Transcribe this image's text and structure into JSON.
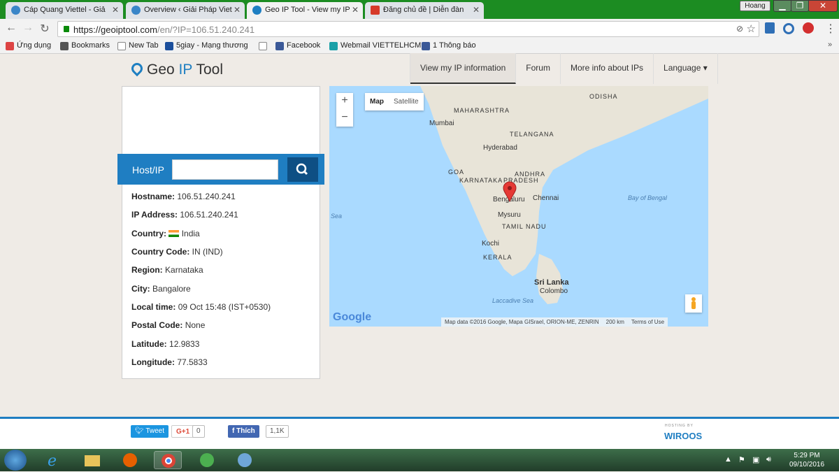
{
  "browser": {
    "tabs": [
      {
        "title": "Cáp Quang Viettel - Giả",
        "favicon_color": "#3a86c8"
      },
      {
        "title": "Overview ‹ Giải Pháp Viet",
        "favicon_color": "#3a86c8"
      },
      {
        "title": "Geo IP Tool - View my IP",
        "favicon_color": "#1e7fc2",
        "active": true
      },
      {
        "title": "Đăng chủ đề | Diễn đàn",
        "favicon_color": "#d63a2a"
      }
    ],
    "user": "Hoang",
    "url_main": "https://geoiptool.com",
    "url_rest": "/en/?IP=106.51.240.241",
    "bookmarks": [
      {
        "label": "Ứng dụng",
        "icon_color": "#d44"
      },
      {
        "label": "Bookmarks",
        "icon_color": "#555"
      },
      {
        "label": "New Tab",
        "icon_color": "#888"
      },
      {
        "label": "5giay - Mạng thương",
        "icon_color": "#1b4f9c"
      },
      {
        "label": "",
        "icon_color": "#888"
      },
      {
        "label": "Facebook",
        "icon_color": "#3b5998"
      },
      {
        "label": "Webmail VIETTELHCM",
        "icon_color": "#1aa0a8"
      },
      {
        "label": "1 Thông báo",
        "icon_color": "#3b5998"
      }
    ]
  },
  "site": {
    "logo_geo": "Geo ",
    "logo_ip": "IP",
    "logo_tool": " Tool",
    "nav": [
      "View my IP information",
      "Forum",
      "More info about IPs",
      "Language ▾"
    ]
  },
  "lookup": {
    "label": "Host/IP",
    "input_value": "",
    "search_icon": "search-icon"
  },
  "info": [
    {
      "label": "Hostname:",
      "value": "106.51.240.241"
    },
    {
      "label": "IP Address:",
      "value": "106.51.240.241"
    },
    {
      "label": "Country:",
      "value": "India"
    },
    {
      "label": "Country Code:",
      "value": "IN (IND)"
    },
    {
      "label": "Region:",
      "value": "Karnataka"
    },
    {
      "label": "City:",
      "value": "Bangalore"
    },
    {
      "label": "Local time:",
      "value": "09 Oct 15:48 (IST+0530)"
    },
    {
      "label": "Postal Code:",
      "value": "None"
    },
    {
      "label": "Latitude:",
      "value": "12.9833"
    },
    {
      "label": "Longitude:",
      "value": "77.5833"
    }
  ],
  "map": {
    "zoom_in": "+",
    "zoom_out": "−",
    "type_map": "Map",
    "type_satellite": "Satellite",
    "labels": [
      "ODISHA",
      "MAHARASHTRA",
      "Mumbai",
      "TELANGANA",
      "Hyderabad",
      "GOA",
      "ANDHRA",
      "KARNATAKA",
      "PRADESH",
      "Bengaluru",
      "Chennai",
      "Bay of Bengal",
      "Sea",
      "Mysuru",
      "TAMIL NADU",
      "Kochi",
      "KERALA",
      "Sri Lanka",
      "Colombo",
      "Laccadive Sea"
    ],
    "google": "Google",
    "attribution": "Map data ©2016 Google, Mapa GISrael, ORION-ME, ZENRIN",
    "scale": "200 km",
    "terms": "Terms of Use",
    "marker_color": "#e53935"
  },
  "footer": {
    "tweet": "Tweet",
    "gplus": "G+1",
    "gplus_count": "0",
    "like": "Thích",
    "like_count": "1,1K",
    "brand_tag": "HOSTING BY",
    "brand": "WIROOS"
  },
  "taskbar": {
    "time": "5:29 PM",
    "date": "09/10/2016"
  }
}
